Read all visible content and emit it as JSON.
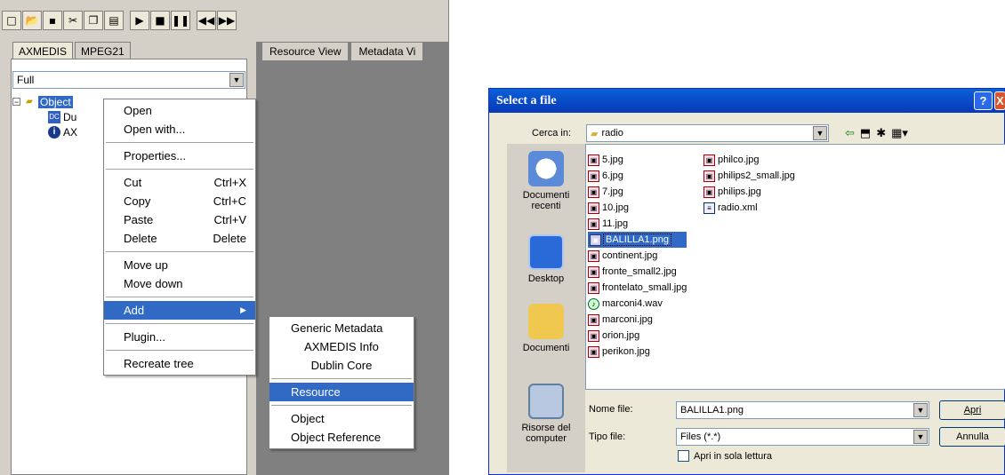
{
  "app": {
    "toolbar_icons": [
      "new-icon",
      "open-icon",
      "save-icon",
      "cut-icon",
      "copy-icon",
      "paste-icon",
      "play-icon",
      "stop-icon",
      "pause-icon",
      "rewind-icon",
      "forward-icon"
    ],
    "tabs": [
      "AXMEDIS",
      "MPEG21"
    ],
    "view_combo": "Full",
    "tree": {
      "root": "Object",
      "children": [
        "Du",
        "AX"
      ]
    },
    "right_tabs": [
      "Resource View",
      "Metadata Vi"
    ]
  },
  "context_menu": {
    "items": [
      {
        "label": "Open",
        "shortcut": ""
      },
      {
        "label": "Open with...",
        "shortcut": ""
      },
      {
        "label": "Properties...",
        "shortcut": ""
      },
      {
        "label": "Cut",
        "shortcut": "Ctrl+X"
      },
      {
        "label": "Copy",
        "shortcut": "Ctrl+C"
      },
      {
        "label": "Paste",
        "shortcut": "Ctrl+V"
      },
      {
        "label": "Delete",
        "shortcut": "Delete"
      },
      {
        "label": "Move up",
        "shortcut": ""
      },
      {
        "label": "Move down",
        "shortcut": ""
      },
      {
        "label": "Add",
        "shortcut": "▶"
      },
      {
        "label": "Plugin...",
        "shortcut": ""
      },
      {
        "label": "Recreate tree",
        "shortcut": ""
      }
    ]
  },
  "submenu": {
    "items": [
      "Generic Metadata",
      "AXMEDIS Info",
      "Dublin Core",
      "Resource",
      "Object",
      "Object Reference"
    ]
  },
  "dialog": {
    "title": "Select a file",
    "help_btn": "?",
    "close_btn": "X",
    "look_in_label": "Cerca in:",
    "look_in_value": "radio",
    "places": [
      "Documenti recenti",
      "Desktop",
      "Documenti",
      "Risorse del computer"
    ],
    "files_col1": [
      "5.jpg",
      "6.jpg",
      "7.jpg",
      "10.jpg",
      "11.jpg",
      "BALILLA1.png",
      "continent.jpg",
      "fronte_small2.jpg",
      "frontelato_small.jpg",
      "marconi4.wav",
      "marconi.jpg",
      "orion.jpg",
      "perikon.jpg"
    ],
    "files_col2": [
      "philco.jpg",
      "philips2_small.jpg",
      "philips.jpg",
      "radio.xml"
    ],
    "filename_label": "Nome file:",
    "filename_value": "BALILLA1.png",
    "filetype_label": "Tipo file:",
    "filetype_value": "Files (*.*)",
    "open_btn": "Apri",
    "cancel_btn": "Annulla",
    "readonly_label": "Apri in sola lettura"
  }
}
